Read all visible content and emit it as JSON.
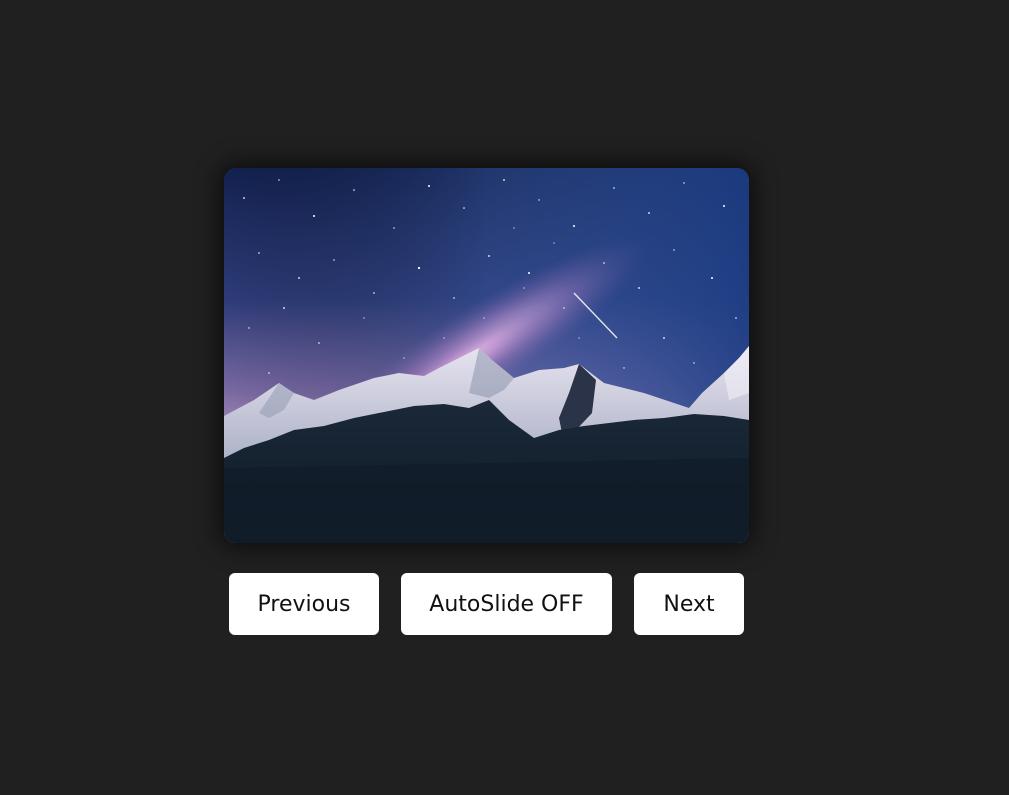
{
  "slideshow": {
    "current_slide": {
      "image": "night-sky-mountains"
    },
    "controls": {
      "previous_label": "Previous",
      "autoslide_label": "AutoSlide OFF",
      "next_label": "Next"
    }
  },
  "colors": {
    "page_background": "#202020",
    "button_background": "#ffffff",
    "button_text": "#111111"
  }
}
